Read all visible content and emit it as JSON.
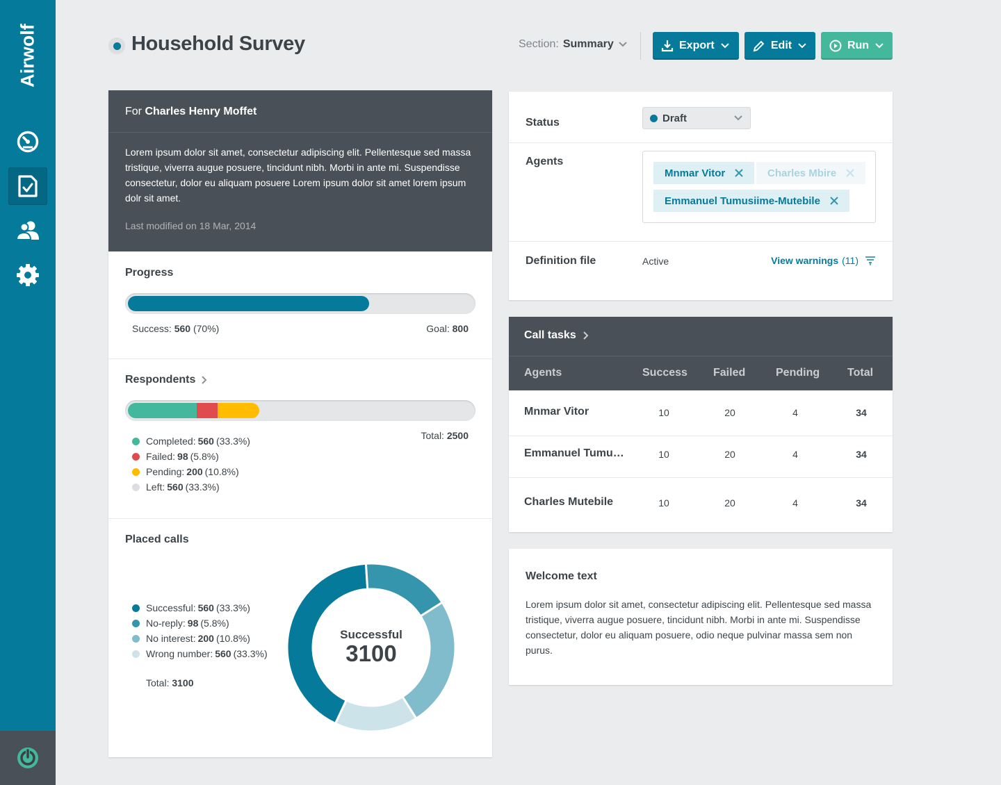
{
  "app": {
    "brand": "Airwolf",
    "nav": [
      {
        "icon": "dashboard-gauge-icon"
      },
      {
        "icon": "survey-checklist-icon",
        "active": true
      },
      {
        "icon": "contacts-users-icon"
      },
      {
        "icon": "settings-gear-icon"
      }
    ],
    "footer_icon": "power-icon"
  },
  "header": {
    "title": "Household Survey",
    "section_label": "Section:",
    "section_value": "Summary",
    "buttons": {
      "export": "Export",
      "edit": "Edit",
      "run": "Run"
    }
  },
  "info": {
    "for_label": "For",
    "for_name": "Charles Henry Moffet",
    "description": "Lorem ipsum dolor sit amet, consectetur adipiscing elit. Pellentesque sed massa tristique, viverra augue posuere, tincidunt nibh. Morbi in ante mi. Suspendisse consectetur, dolor eu aliquam posuere Lorem ipsum dolor sit amet lorem ipsum dolr sit amet.",
    "last_modified": "Last modified on 18 Mar, 2014"
  },
  "progress": {
    "title": "Progress",
    "fraction": 0.7,
    "success_label": "Success:",
    "success_value": "560",
    "success_pct": "(70%)",
    "goal_label": "Goal:",
    "goal_value": "800"
  },
  "respondents": {
    "title": "Respondents",
    "total_label": "Total:",
    "total_value": "2500",
    "segments": [
      {
        "label": "Completed:",
        "value": "560",
        "pct": "(33.3%)",
        "color": "#44b89c",
        "share": 0.2
      },
      {
        "label": "Failed:",
        "value": "98",
        "pct": "(5.8%)",
        "color": "#e04b4e",
        "share": 0.06
      },
      {
        "label": "Pending:",
        "value": "200",
        "pct": "(10.8%)",
        "color": "#ffbc00",
        "share": 0.12
      },
      {
        "label": "Left:",
        "value": "560",
        "pct": "(33.3%)",
        "color": "#dcdee1",
        "share": 0
      }
    ]
  },
  "placed_calls": {
    "title": "Placed calls",
    "total_label": "Total:",
    "total_value": "3100",
    "center_label": "Successful",
    "center_value": "3100",
    "legend": [
      {
        "label": "Successful:",
        "value": "560",
        "pct": "(33.3%)",
        "color": "#057a9b"
      },
      {
        "label": "No-reply:",
        "value": "98",
        "pct": "(5.8%)",
        "color": "#3595ac"
      },
      {
        "label": "No interest:",
        "value": "200",
        "pct": "(10.8%)",
        "color": "#80bccc"
      },
      {
        "label": "Wrong number:",
        "value": "560",
        "pct": "(33.3%)",
        "color": "#cce3ea"
      }
    ]
  },
  "chart_data": {
    "type": "pie",
    "title": "Placed calls",
    "categories": [
      "Successful",
      "No-reply",
      "No interest",
      "Wrong number"
    ],
    "values": [
      0.42,
      0.17,
      0.25,
      0.16
    ],
    "colors": [
      "#057a9b",
      "#3595ac",
      "#80bccc",
      "#cce3ea"
    ]
  },
  "details": {
    "status_label": "Status",
    "status_value": "Draft",
    "status_color": "#057a9b",
    "agents_label": "Agents",
    "agents": [
      {
        "name": "Mnmar Vitor"
      },
      {
        "name": "Charles Mbire",
        "faded": true
      },
      {
        "name": "Emmanuel Tumusiime-Mutebile"
      }
    ],
    "definition_label": "Definition file",
    "definition_value": "Active",
    "warnings_label": "View warnings",
    "warnings_count": "(11)"
  },
  "call_tasks": {
    "title": "Call tasks",
    "columns": [
      "Agents",
      "Success",
      "Failed",
      "Pending",
      "Total"
    ],
    "rows": [
      {
        "agent": "Mnmar Vitor",
        "success": "10",
        "failed": "20",
        "pending": "4",
        "total": "34"
      },
      {
        "agent": "Emmanuel Tumusiime-Mutebile",
        "success": "10",
        "failed": "20",
        "pending": "4",
        "total": "34"
      },
      {
        "agent": "Charles Mutebile",
        "success": "10",
        "failed": "20",
        "pending": "4",
        "total": "34"
      }
    ]
  },
  "welcome": {
    "title": "Welcome text",
    "body": "Lorem ipsum dolor sit amet, consectetur adipiscing elit. Pellentesque sed massa tristique, viverra augue posuere, tincidunt nibh. Morbi in ante mi. Suspendisse consectetur, dolor eu aliquam posuere, odio neque pulvinar massa sem non purus."
  }
}
